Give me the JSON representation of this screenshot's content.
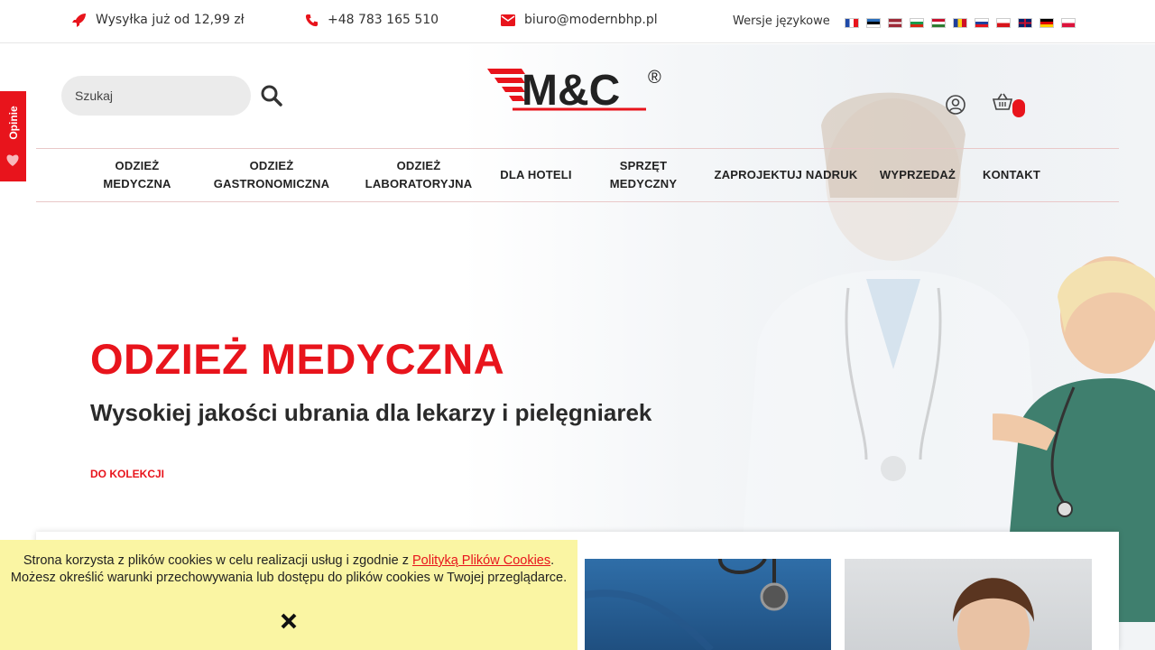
{
  "topbar": {
    "shipping": "Wysyłka już od 12,99 zł",
    "phone": "+48 783 165 510",
    "email": "biuro@modernbhp.pl",
    "languages_label": "Wersje językowe",
    "flags": [
      "fr",
      "ee",
      "lv",
      "bg",
      "hu",
      "ro",
      "sk",
      "cz",
      "gb",
      "de",
      "pl"
    ]
  },
  "header": {
    "search_placeholder": "Szukaj",
    "logo_text": "M&C",
    "logo_mark": "®"
  },
  "side_tab": {
    "label": "Opinie"
  },
  "nav": {
    "items": [
      {
        "line1": "ODZIEŻ",
        "line2": "MEDYCZNA"
      },
      {
        "line1": "ODZIEŻ",
        "line2": "GASTRONOMICZNA"
      },
      {
        "line1": "ODZIEŻ",
        "line2": "LABORATORYJNA"
      },
      {
        "line1": "DLA HOTELI",
        "line2": ""
      },
      {
        "line1": "SPRZĘT",
        "line2": "MEDYCZNY"
      },
      {
        "line1": "ZAPROJEKTUJ NADRUK",
        "line2": ""
      },
      {
        "line1": "WYPRZEDAŻ",
        "line2": ""
      },
      {
        "line1": "KONTAKT",
        "line2": ""
      }
    ]
  },
  "hero": {
    "title": "ODZIEŻ MEDYCZNA",
    "subtitle": "Wysokiej jakości ubrania dla lekarzy i pielęgniarek",
    "cta": "DO KOLEKCJI"
  },
  "cookie": {
    "text_before": "Strona korzysta z plików cookies w celu realizacji usług i zgodnie z ",
    "link": "Polityką Plików Cookies",
    "text_after": ". Możesz określić warunki przechowywania lub dostępu do plików cookies w Twojej przeglądarce."
  },
  "colors": {
    "accent": "#e8141c",
    "cookie_bg": "#faf5a3"
  }
}
